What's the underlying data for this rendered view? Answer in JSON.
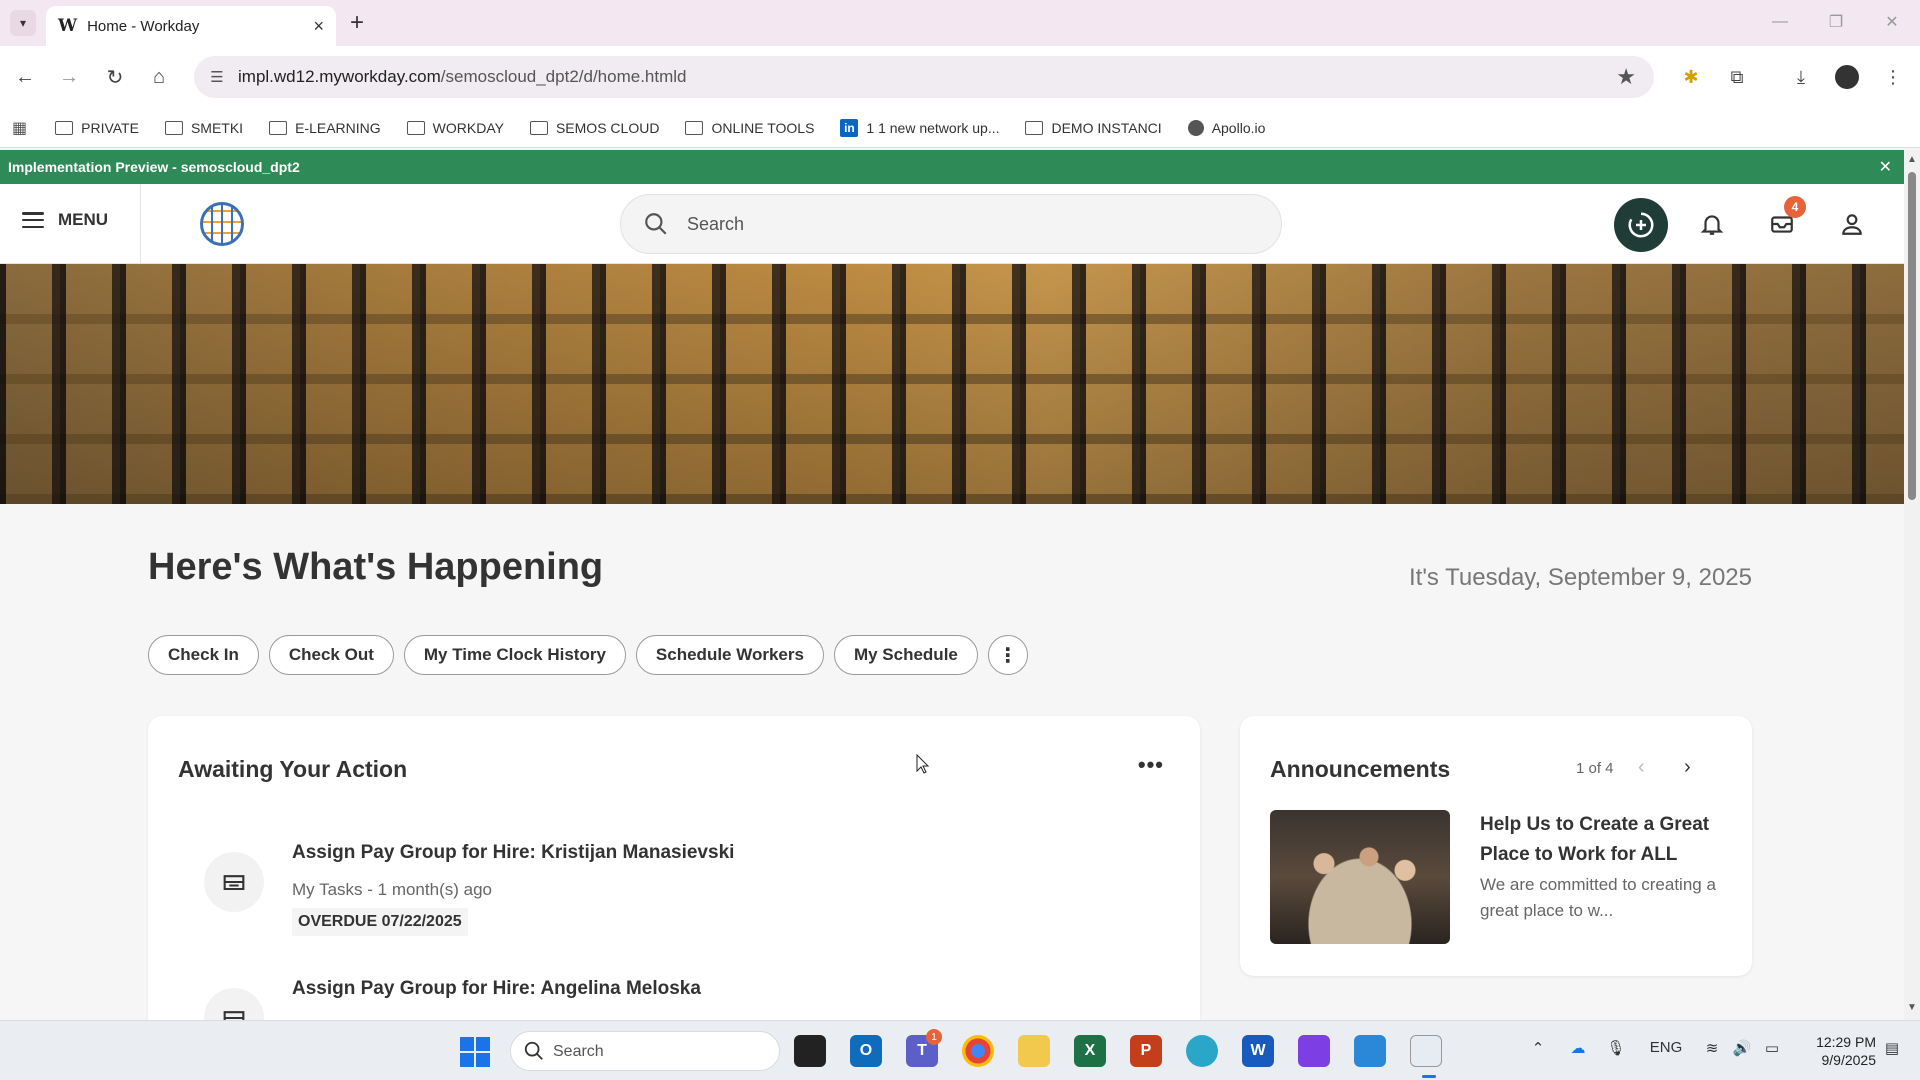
{
  "browser": {
    "tab_title": "Home - Workday",
    "url_host": "impl.wd12.myworkday.com",
    "url_path": "/semoscloud_dpt2/d/home.htmld",
    "bookmarks": [
      {
        "label": "PRIVATE",
        "icon": "folder-icon"
      },
      {
        "label": "SMETKI",
        "icon": "folder-icon"
      },
      {
        "label": "E-LEARNING",
        "icon": "folder-icon"
      },
      {
        "label": "WORKDAY",
        "icon": "folder-icon"
      },
      {
        "label": "SEMOS CLOUD",
        "icon": "folder-icon"
      },
      {
        "label": "ONLINE TOOLS",
        "icon": "folder-icon"
      },
      {
        "label": "1 1 new network up...",
        "icon": "linkedin-icon"
      },
      {
        "label": "DEMO INSTANCI",
        "icon": "folder-icon"
      },
      {
        "label": "Apollo.io",
        "icon": "globe-icon"
      }
    ]
  },
  "app": {
    "impl_banner": "Implementation Preview - semoscloud_dpt2",
    "menu_label": "MENU",
    "search_placeholder": "Search",
    "inbox_badge": "4",
    "colors": {
      "banner": "#2e8b57",
      "assistant": "#1f3d36",
      "badge": "#e8623a"
    }
  },
  "home": {
    "title": "Here's What's Happening",
    "date": "It's Tuesday, September 9, 2025",
    "quick_actions": [
      "Check In",
      "Check Out",
      "My Time Clock History",
      "Schedule Workers",
      "My Schedule"
    ],
    "awaiting": {
      "title": "Awaiting Your Action",
      "tasks": [
        {
          "title": "Assign Pay Group for Hire: Kristijan Manasievski",
          "subtitle": "My Tasks - 1 month(s) ago",
          "due": "OVERDUE 07/22/2025"
        },
        {
          "title": "Assign Pay Group for Hire: Angelina Meloska"
        }
      ]
    },
    "announcements": {
      "title": "Announcements",
      "pager": "1 of 4",
      "headline": "Help Us to Create a Great Place to Work for ALL",
      "body": "We are committed to creating a great place to w..."
    }
  },
  "taskbar": {
    "search_placeholder": "Search",
    "teams_badge": "1",
    "language": "ENG",
    "time": "12:29 PM",
    "date": "9/9/2025"
  }
}
